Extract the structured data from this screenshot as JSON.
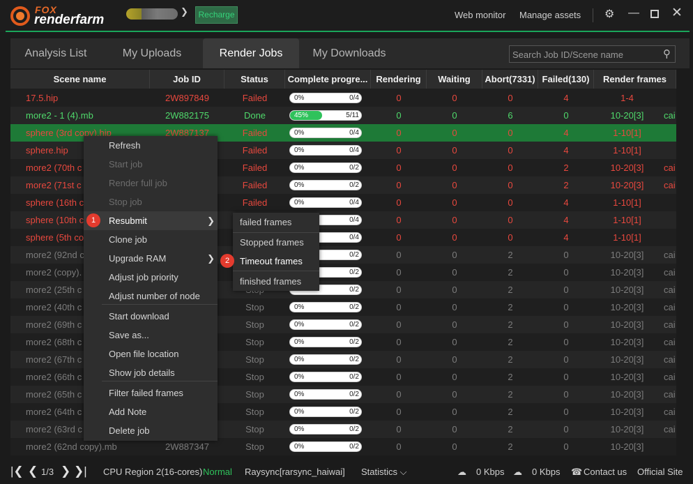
{
  "app": {
    "logo_top": "FOX",
    "logo_bottom": "renderfarm"
  },
  "topbar": {
    "recharge": "Recharge",
    "web_monitor": "Web monitor",
    "manage_assets": "Manage assets",
    "settings_icon": "gear-icon",
    "minimize_icon": "minimize-icon",
    "maximize_icon": "maximize-icon",
    "close_icon": "close-icon"
  },
  "tabs": [
    "Analysis List",
    "My Uploads",
    "Render Jobs",
    "My Downloads"
  ],
  "active_tab": "Render Jobs",
  "search": {
    "placeholder": "Search Job ID/Scene name"
  },
  "table": {
    "headers": [
      "Scene name",
      "Job ID",
      "Status",
      "Complete progre...",
      "Rendering",
      "Waiting",
      "Abort(7331)",
      "Failed(130)",
      "Render frames"
    ],
    "rows": [
      {
        "scene": "17.5.hip",
        "job_id": "2W897849",
        "status": "Failed",
        "progress": "0%",
        "progress_value": 0,
        "frames_done": "0/4",
        "rendering": "0",
        "waiting": "0",
        "abort": "0",
        "failed": "4",
        "render_frames": "1-4",
        "extra": "",
        "tone": "failed"
      },
      {
        "scene": "more2 - 1 (4).mb",
        "job_id": "2W882175",
        "status": "Done",
        "progress": "45%",
        "progress_value": 45,
        "frames_done": "5/11",
        "rendering": "0",
        "waiting": "0",
        "abort": "6",
        "failed": "0",
        "render_frames": "10-20[3]",
        "extra": "cai",
        "tone": "done"
      },
      {
        "scene": "sphere (3rd copy).hip",
        "job_id": "2W887137",
        "status": "Failed",
        "progress": "0%",
        "progress_value": 0,
        "frames_done": "0/4",
        "rendering": "0",
        "waiting": "0",
        "abort": "0",
        "failed": "4",
        "render_frames": "1-10[1]",
        "extra": "",
        "tone": "selected"
      },
      {
        "scene": "sphere.hip",
        "job_id": "",
        "status": "Failed",
        "progress": "0%",
        "progress_value": 0,
        "frames_done": "0/4",
        "rendering": "0",
        "waiting": "0",
        "abort": "0",
        "failed": "4",
        "render_frames": "1-10[1]",
        "extra": "",
        "tone": "failed"
      },
      {
        "scene": "more2 (70th c",
        "job_id": "",
        "status": "Failed",
        "progress": "0%",
        "progress_value": 0,
        "frames_done": "0/2",
        "rendering": "0",
        "waiting": "0",
        "abort": "0",
        "failed": "2",
        "render_frames": "10-20[3]",
        "extra": "cai",
        "tone": "failed"
      },
      {
        "scene": "more2 (71st c",
        "job_id": "",
        "status": "Failed",
        "progress": "0%",
        "progress_value": 0,
        "frames_done": "0/2",
        "rendering": "0",
        "waiting": "0",
        "abort": "0",
        "failed": "2",
        "render_frames": "10-20[3]",
        "extra": "cai",
        "tone": "failed"
      },
      {
        "scene": "sphere (16th c",
        "job_id": "",
        "status": "Failed",
        "progress": "0%",
        "progress_value": 0,
        "frames_done": "0/4",
        "rendering": "0",
        "waiting": "0",
        "abort": "0",
        "failed": "4",
        "render_frames": "1-10[1]",
        "extra": "",
        "tone": "failed"
      },
      {
        "scene": "sphere (10th c",
        "job_id": "",
        "status": "",
        "progress": "",
        "progress_value": 0,
        "frames_done": "0/4",
        "rendering": "0",
        "waiting": "0",
        "abort": "0",
        "failed": "4",
        "render_frames": "1-10[1]",
        "extra": "",
        "tone": "failed"
      },
      {
        "scene": "sphere (5th co",
        "job_id": "",
        "status": "",
        "progress": "",
        "progress_value": 0,
        "frames_done": "0/4",
        "rendering": "0",
        "waiting": "0",
        "abort": "0",
        "failed": "4",
        "render_frames": "1-10[1]",
        "extra": "",
        "tone": "failed"
      },
      {
        "scene": "more2 (92nd c",
        "job_id": "",
        "status": "",
        "progress": "",
        "progress_value": 0,
        "frames_done": "0/2",
        "rendering": "0",
        "waiting": "0",
        "abort": "2",
        "failed": "0",
        "render_frames": "10-20[3]",
        "extra": "cai",
        "tone": "stop"
      },
      {
        "scene": "more2 (copy).",
        "job_id": "",
        "status": "",
        "progress": "",
        "progress_value": 0,
        "frames_done": "0/2",
        "rendering": "0",
        "waiting": "0",
        "abort": "2",
        "failed": "0",
        "render_frames": "10-20[3]",
        "extra": "cai",
        "tone": "stop"
      },
      {
        "scene": "more2 (25th c",
        "job_id": "",
        "status": "Stop",
        "progress": "",
        "progress_value": 0,
        "frames_done": "0/2",
        "rendering": "0",
        "waiting": "0",
        "abort": "2",
        "failed": "0",
        "render_frames": "10-20[3]",
        "extra": "cai",
        "tone": "stop"
      },
      {
        "scene": "more2 (40th c",
        "job_id": "",
        "status": "Stop",
        "progress": "0%",
        "progress_value": 0,
        "frames_done": "0/2",
        "rendering": "0",
        "waiting": "0",
        "abort": "2",
        "failed": "0",
        "render_frames": "10-20[3]",
        "extra": "cai",
        "tone": "stop"
      },
      {
        "scene": "more2 (69th c",
        "job_id": "",
        "status": "Stop",
        "progress": "0%",
        "progress_value": 0,
        "frames_done": "0/2",
        "rendering": "0",
        "waiting": "0",
        "abort": "2",
        "failed": "0",
        "render_frames": "10-20[3]",
        "extra": "cai",
        "tone": "stop"
      },
      {
        "scene": "more2 (68th c",
        "job_id": "",
        "status": "Stop",
        "progress": "0%",
        "progress_value": 0,
        "frames_done": "0/2",
        "rendering": "0",
        "waiting": "0",
        "abort": "2",
        "failed": "0",
        "render_frames": "10-20[3]",
        "extra": "cai",
        "tone": "stop"
      },
      {
        "scene": "more2 (67th c",
        "job_id": "",
        "status": "Stop",
        "progress": "0%",
        "progress_value": 0,
        "frames_done": "0/2",
        "rendering": "0",
        "waiting": "0",
        "abort": "2",
        "failed": "0",
        "render_frames": "10-20[3]",
        "extra": "cai",
        "tone": "stop"
      },
      {
        "scene": "more2 (66th c",
        "job_id": "",
        "status": "Stop",
        "progress": "0%",
        "progress_value": 0,
        "frames_done": "0/2",
        "rendering": "0",
        "waiting": "0",
        "abort": "2",
        "failed": "0",
        "render_frames": "10-20[3]",
        "extra": "cai",
        "tone": "stop"
      },
      {
        "scene": "more2 (65th c",
        "job_id": "",
        "status": "Stop",
        "progress": "0%",
        "progress_value": 0,
        "frames_done": "0/2",
        "rendering": "0",
        "waiting": "0",
        "abort": "2",
        "failed": "0",
        "render_frames": "10-20[3]",
        "extra": "cai",
        "tone": "stop"
      },
      {
        "scene": "more2 (64th c",
        "job_id": "",
        "status": "Stop",
        "progress": "0%",
        "progress_value": 0,
        "frames_done": "0/2",
        "rendering": "0",
        "waiting": "0",
        "abort": "2",
        "failed": "0",
        "render_frames": "10-20[3]",
        "extra": "cai",
        "tone": "stop"
      },
      {
        "scene": "more2 (63rd c",
        "job_id": "",
        "status": "Stop",
        "progress": "0%",
        "progress_value": 0,
        "frames_done": "0/2",
        "rendering": "0",
        "waiting": "0",
        "abort": "2",
        "failed": "0",
        "render_frames": "10-20[3]",
        "extra": "cai",
        "tone": "stop"
      },
      {
        "scene": "more2 (62nd copy).mb",
        "job_id": "2W887347",
        "status": "Stop",
        "progress": "0%",
        "progress_value": 0,
        "frames_done": "0/2",
        "rendering": "0",
        "waiting": "0",
        "abort": "2",
        "failed": "0",
        "render_frames": "10-20[3]",
        "extra": "",
        "tone": "stop"
      }
    ]
  },
  "context_menu": {
    "items": [
      {
        "label": "Refresh",
        "disabled": false,
        "submenu": false
      },
      {
        "label": "Start job",
        "disabled": true,
        "submenu": false
      },
      {
        "label": "Render full job",
        "disabled": true,
        "submenu": false
      },
      {
        "label": "Stop job",
        "disabled": true,
        "submenu": false
      },
      {
        "label": "Resubmit",
        "disabled": false,
        "submenu": true,
        "badge": "1",
        "active": true
      },
      {
        "label": "Clone job",
        "disabled": false,
        "submenu": false
      },
      {
        "label": "Upgrade RAM",
        "disabled": false,
        "submenu": true
      },
      {
        "label": "Adjust job priority",
        "disabled": false,
        "submenu": false
      },
      {
        "label": "Adjust number of node",
        "disabled": false,
        "submenu": false
      },
      {
        "label": "Start download",
        "disabled": false,
        "submenu": false
      },
      {
        "label": "Save as...",
        "disabled": false,
        "submenu": false
      },
      {
        "label": "Open file location",
        "disabled": false,
        "submenu": false
      },
      {
        "label": "Show job details",
        "disabled": false,
        "submenu": false
      },
      {
        "label": "Filter failed frames",
        "disabled": false,
        "submenu": false
      },
      {
        "label": "Add Note",
        "disabled": false,
        "submenu": false
      },
      {
        "label": "Delete job",
        "disabled": false,
        "submenu": false
      }
    ]
  },
  "submenu": {
    "items": [
      {
        "label": "failed frames"
      },
      {
        "label": "Stopped frames"
      },
      {
        "label": "Timeout frames",
        "badge": "2",
        "active": true
      },
      {
        "label": "finished frames"
      }
    ]
  },
  "footer": {
    "page": "1/3",
    "region": "CPU Region 2(16-cores)",
    "region_state": "Normal",
    "transfer": "Raysync[rarsync_haiwai]",
    "statistics": "Statistics",
    "upload_speed": "0 Kbps",
    "download_speed": "0 Kbps",
    "contact": "Contact us",
    "official_site": "Official Site"
  },
  "colors": {
    "accent": "#1aa65a",
    "failed": "#e8483e",
    "done": "#4fd96b",
    "stop": "#7c7c7c",
    "selected_row": "#1e7a37"
  }
}
